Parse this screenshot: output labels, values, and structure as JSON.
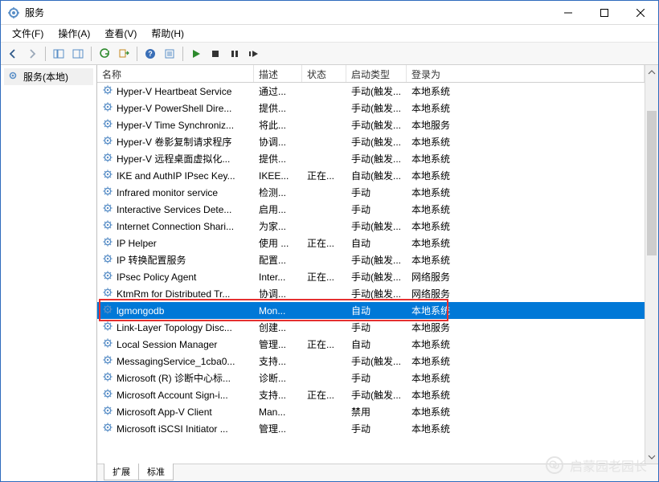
{
  "window": {
    "title": "服务"
  },
  "menu": {
    "file": "文件(F)",
    "action": "操作(A)",
    "view": "查看(V)",
    "help": "帮助(H)"
  },
  "nav": {
    "root": "服务(本地)"
  },
  "columns": {
    "name": "名称",
    "desc": "描述",
    "status": "状态",
    "startup": "启动类型",
    "logon": "登录为"
  },
  "services": [
    {
      "name": "Hyper-V Heartbeat Service",
      "desc": "通过...",
      "status": "",
      "startup": "手动(触发...",
      "logon": "本地系统"
    },
    {
      "name": "Hyper-V PowerShell Dire...",
      "desc": "提供...",
      "status": "",
      "startup": "手动(触发...",
      "logon": "本地系统"
    },
    {
      "name": "Hyper-V Time Synchroniz...",
      "desc": "将此...",
      "status": "",
      "startup": "手动(触发...",
      "logon": "本地服务"
    },
    {
      "name": "Hyper-V 卷影复制请求程序",
      "desc": "协调...",
      "status": "",
      "startup": "手动(触发...",
      "logon": "本地系统"
    },
    {
      "name": "Hyper-V 远程桌面虚拟化...",
      "desc": "提供...",
      "status": "",
      "startup": "手动(触发...",
      "logon": "本地系统"
    },
    {
      "name": "IKE and AuthIP IPsec Key...",
      "desc": "IKEE...",
      "status": "正在...",
      "startup": "自动(触发...",
      "logon": "本地系统"
    },
    {
      "name": "Infrared monitor service",
      "desc": "检测...",
      "status": "",
      "startup": "手动",
      "logon": "本地系统"
    },
    {
      "name": "Interactive Services Dete...",
      "desc": "启用...",
      "status": "",
      "startup": "手动",
      "logon": "本地系统"
    },
    {
      "name": "Internet Connection Shari...",
      "desc": "为家...",
      "status": "",
      "startup": "手动(触发...",
      "logon": "本地系统"
    },
    {
      "name": "IP Helper",
      "desc": "使用 ...",
      "status": "正在...",
      "startup": "自动",
      "logon": "本地系统"
    },
    {
      "name": "IP 转换配置服务",
      "desc": "配置...",
      "status": "",
      "startup": "手动(触发...",
      "logon": "本地系统"
    },
    {
      "name": "IPsec Policy Agent",
      "desc": "Inter...",
      "status": "正在...",
      "startup": "手动(触发...",
      "logon": "网络服务"
    },
    {
      "name": "KtmRm for Distributed Tr...",
      "desc": "协调...",
      "status": "",
      "startup": "手动(触发...",
      "logon": "网络服务"
    },
    {
      "name": "lgmongodb",
      "desc": "Mon...",
      "status": "",
      "startup": "自动",
      "logon": "本地系统",
      "selected": true
    },
    {
      "name": "Link-Layer Topology Disc...",
      "desc": "创建...",
      "status": "",
      "startup": "手动",
      "logon": "本地服务"
    },
    {
      "name": "Local Session Manager",
      "desc": "管理...",
      "status": "正在...",
      "startup": "自动",
      "logon": "本地系统"
    },
    {
      "name": "MessagingService_1cba0...",
      "desc": "支持...",
      "status": "",
      "startup": "手动(触发...",
      "logon": "本地系统"
    },
    {
      "name": "Microsoft (R) 诊断中心标...",
      "desc": "诊断...",
      "status": "",
      "startup": "手动",
      "logon": "本地系统"
    },
    {
      "name": "Microsoft Account Sign-i...",
      "desc": "支持...",
      "status": "正在...",
      "startup": "手动(触发...",
      "logon": "本地系统"
    },
    {
      "name": "Microsoft App-V Client",
      "desc": "Man...",
      "status": "",
      "startup": "禁用",
      "logon": "本地系统"
    },
    {
      "name": "Microsoft iSCSI Initiator ...",
      "desc": "管理...",
      "status": "",
      "startup": "手动",
      "logon": "本地系统"
    }
  ],
  "tabs": {
    "extended": "扩展",
    "standard": "标准"
  },
  "watermark": {
    "text": "启蒙园老园长"
  }
}
